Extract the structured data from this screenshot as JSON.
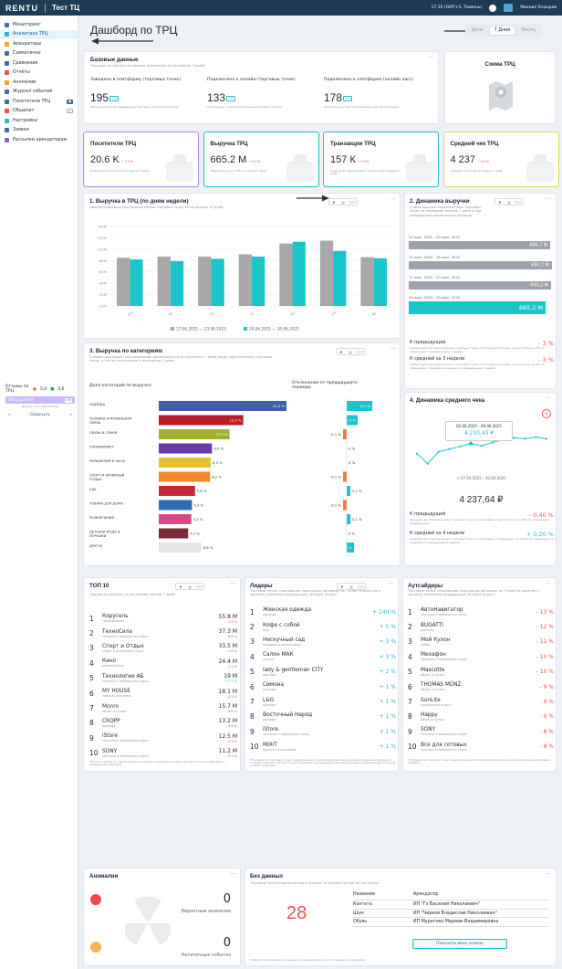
{
  "topbar": {
    "logo": "RENTU",
    "mall": "Тест ТЦ",
    "time": "17:35 (GMT+5, Тюмень)",
    "user": "Михаил Козырев"
  },
  "sidebar": {
    "items": [
      {
        "label": "Мониторинг",
        "color": "#3d6ea3"
      },
      {
        "label": "Аналитика ТРЦ",
        "color": "#2ab8c9",
        "active": true
      },
      {
        "label": "Арендаторы",
        "color": "#f0a12a"
      },
      {
        "label": "Схематично",
        "color": "#3d6ea3"
      },
      {
        "label": "Сравнение",
        "color": "#3d6ea3"
      },
      {
        "label": "Отчёты",
        "color": "#e9544a"
      },
      {
        "label": "Аномалии",
        "color": "#f0a12a"
      },
      {
        "label": "Журнал событий",
        "color": "#3d6ea3"
      },
      {
        "label": "Посетители ТРЦ",
        "color": "#3d6ea3",
        "badge": "●"
      },
      {
        "label": "Общепит",
        "color": "#e9544a",
        "badge": "◻"
      },
      {
        "label": "Настройки",
        "color": "#2ab8c9"
      },
      {
        "label": "Заявки",
        "color": "#3d6ea3"
      },
      {
        "label": "Рассылки арендаторам",
        "color": "#8e5fd6"
      }
    ],
    "reviews_label": "Отзывы по ТРЦ",
    "rating1": "5,0",
    "rating2": "4,6",
    "appeals": "Обращения",
    "appeals_badge": "199",
    "version": "Версия 4.0.1 (20.06.2025)",
    "collapse": "Свернуть"
  },
  "header": {
    "title": "Дашборд по ТРЦ",
    "periods": [
      "День",
      "7 Дней",
      "Месяц"
    ]
  },
  "basic": {
    "title": "Базовые данные",
    "subtitle": "Текущее состояние платформы (изменение за последние 7 дней)",
    "cols": [
      {
        "label": "Заведено в платформу (торговых точек)",
        "value": "195",
        "badge": "+10",
        "note": "Общее количество заведенных торговых точек в платформу"
      },
      {
        "label": "Подключено к онлайн (торговых точек)",
        "value": "133",
        "badge": "+12",
        "note": "Подключено к автоматизированному сбору продаж"
      },
      {
        "label": "Подключено к платформе (онлайн касс)",
        "value": "178",
        "badge": "+12",
        "note": "Подключено к автоматизированному сбору продаж"
      }
    ]
  },
  "scheme": {
    "title": "Схема ТРЦ"
  },
  "kpis": [
    {
      "title": "Посетители ТРЦ",
      "value": "20.6 K",
      "delta": "+ 0.3 %",
      "note": "Количество посетителей за неделю 7 дней",
      "border": "#a98ee0"
    },
    {
      "title": "Выручка ТРЦ",
      "value": "665.2 М",
      "delta": "+ 0.4 %",
      "note": "Общая выручка по ТРЦ за неделю 7 дней",
      "border": "#2ab8c9"
    },
    {
      "title": "Транзакции ТРЦ",
      "value": "157 К",
      "delta": "+ 0.3 %",
      "note": "Количество транзакций по чекам в ТРЦ за неделю 7 дней",
      "border": "#2ab8c9"
    },
    {
      "title": "Средний чек ТРЦ",
      "value": "4 237",
      "delta": "+ 0.4 %",
      "note": "Средний чек по ТРЦ за неделю 7 дней",
      "border": "#e5d45a"
    }
  ],
  "rev_days": {
    "title": "1. Выручка в ТРЦ (по дням недели)",
    "subtitle": "Общая сумма выручки подключенных торговых точек за последние 14 дней",
    "toggle": [
      "₽",
      "▦",
      "TOP"
    ]
  },
  "dyn_rev": {
    "title": "2. Динамика выручки",
    "subtitle": "Сумма выручки подключенных торговых точек за последние полные 7 дней и три предыдущие аналогичных периода",
    "periods": [
      {
        "label": "03 июн. 2025 - 09 июн. 2025",
        "value": "686,7 М"
      },
      {
        "label": "10 июн. 2025 - 16 июн. 2025",
        "value": "694,2 М"
      },
      {
        "label": "17 июн. 2025 - 23 июн. 2025",
        "value": "690,2 М"
      },
      {
        "label": "24 июн. 2025 - 30 июн. 2025",
        "value": "665,2 М"
      }
    ],
    "prev_label": "К предыдущей",
    "prev_val": "- 3 %",
    "prev_note": "Сумма выручки подключенных торговых точек за последние полные 7 дней упала на 3% по сравнению с предыдущими 7 днями",
    "three_label": "К средней за 3 недели",
    "three_val": "- 3 %",
    "three_note": "Сумма выручки подключенных торговых точек за последние полные 7 дней упала на 3% по сравнению с средним значением за предыдущие 3 недели"
  },
  "cat": {
    "title": "3. Выручка по категориям",
    "subtitle": "График показывает распределение долей выручки за последние 7 дней среди подключенных торговых точек, а так же отклонение к последним 7 дням",
    "left_title": "Доля категорий по выручке",
    "right_title": "Отклонение от предыдущего периода",
    "rows": [
      {
        "name": "ОДЕЖДА",
        "pct": "20,4 %",
        "dev": "0,7 %"
      },
      {
        "name": "ТЕХНИКА И МОБИЛЬНАЯ СВЯЗЬ",
        "pct": "13,5 %",
        "dev": "0,3 %"
      },
      {
        "name": "ОБУВЬ И СУМКИ",
        "pct": "11,3 %",
        "dev": "-0,1 %"
      },
      {
        "name": "ГИПЕРМАРКЕТ",
        "pct": "8,5 %",
        "dev": "0 %"
      },
      {
        "name": "УКРАШЕНИЯ И ЧАСЫ",
        "pct": "8,3 %",
        "dev": "0 %"
      },
      {
        "name": "СПОРТ И АКТИВНЫЙ ОТДЫХ",
        "pct": "8,2 %",
        "dev": "-0,1 %"
      },
      {
        "name": "ЕДА",
        "pct": "5,8 %",
        "dev": "0,1 %"
      },
      {
        "name": "ТОВАРЫ ДЛЯ ДОМА",
        "pct": "5,3 %",
        "dev": "-0,1 %"
      },
      {
        "name": "РАЗВЛЕЧЕНИЯ",
        "pct": "5,2 %",
        "dev": "0,1 %"
      },
      {
        "name": "ДЕТСКАЯ МОДА И ИГРУШКИ",
        "pct": "4,7 %",
        "dev": "0 %"
      },
      {
        "name": "ДРУГОЕ",
        "pct": "6,8 %",
        "dev": "0,2 %"
      }
    ]
  },
  "avg": {
    "title": "4. Динамика среднего чека",
    "tooltip_date": "02.06.2025 - 09.06.2025",
    "tooltip_val": "4 230,43 ₽",
    "range": "07.04.2025 - 30.06.2025",
    "value": "4 237,64 ₽",
    "prev_label": "К предыдущей",
    "prev_val": "- 0,40 %",
    "prev_note": "Средний чек подключенных торговых точек за последние 7 дней упал на 0,40% по сравнению с предыдущей",
    "four_label": "К средней за 4 недели",
    "four_val": "+ 0,20 %",
    "four_note": "Средний чек подключенных торговых точек за последние 7 дней вырос на 0,20% по сравнению со средним за предыдущие 4 недели"
  },
  "top10": {
    "title": "ТОП 10",
    "subtitle": "Лидеры по выручке за последние полные 7 дней",
    "rows": [
      {
        "n": "1",
        "name": "Корусель",
        "cat": "гипермаркет",
        "val": "55.8 М",
        "d": "- 3.8 %"
      },
      {
        "n": "2",
        "name": "ТехноСила",
        "cat": "техника и мобильная связь",
        "val": "37.3 М",
        "d": "- 6.9 %"
      },
      {
        "n": "3",
        "name": "Спорт и Отдых",
        "cat": "спорт и активный отдых",
        "val": "33.5 М",
        "d": "- 2.6 %"
      },
      {
        "n": "4",
        "name": "Кино",
        "cat": "развлечения",
        "val": "24.4 М",
        "d": "- 2.1 %"
      },
      {
        "n": "5",
        "name": "Технологии АБ",
        "cat": "техника и мобильная связь",
        "val": "19 М",
        "d": "+ 0.2 %"
      },
      {
        "n": "6",
        "name": "MY HOUSE",
        "cat": "товары для дома",
        "val": "18.1 М",
        "d": "- 4.5 %"
      },
      {
        "n": "7",
        "name": "Monro",
        "cat": "обувь и сумки",
        "val": "15.7 М",
        "d": "- 0.8 %"
      },
      {
        "n": "8",
        "name": "CROPP",
        "cat": "одежда",
        "val": "13.2 М",
        "d": "- 4.6 %"
      },
      {
        "n": "9",
        "name": "iStore",
        "cat": "техника и мобильная связь",
        "val": "12.5 М",
        "d": "- 2.9 %"
      },
      {
        "n": "10",
        "name": "SONY",
        "cat": "техника и мобильная связь",
        "val": "11.2 М",
        "d": "- 9.3 %"
      }
    ],
    "footnote": "*Число со знаком +/- рядом номера показывает изменение позиции торговой точки по сравнению с предыдущим периодом"
  },
  "leaders": {
    "title": "Лидеры",
    "subtitle": "Торговые точки, показавшие наилучшую динамику за 7 дней по выручке к средним значениям предыдущих четырех недель",
    "rows": [
      {
        "n": "1",
        "name": "Женская одежда",
        "cat": "одежда",
        "val": "+ 240 %"
      },
      {
        "n": "2",
        "name": "Кофе с собой",
        "cat": "еда",
        "val": "+ 5 %"
      },
      {
        "n": "3",
        "name": "Нескучный сад",
        "cat": "подарки и аксессуары",
        "val": "+ 3 %"
      },
      {
        "n": "4",
        "name": "Салон МАК",
        "cat": "услуги",
        "val": "+ 3 %"
      },
      {
        "n": "5",
        "name": "lady & gentleman CITY",
        "cat": "одежда",
        "val": "+ 2 %"
      },
      {
        "n": "6",
        "name": "Симона",
        "cat": "одежда",
        "val": "+ 1 %"
      },
      {
        "n": "7",
        "name": "L&G",
        "cat": "одежда",
        "val": "+ 1 %"
      },
      {
        "n": "8",
        "name": "Восточный Наряд",
        "cat": "одежда",
        "val": "+ 1 %"
      },
      {
        "n": "9",
        "name": "iStore",
        "cat": "техника и мобильная связь",
        "val": "+ 1 %"
      },
      {
        "n": "10",
        "name": "MIXIT",
        "cat": "красота и здоровье",
        "val": "+ 1 %"
      }
    ],
    "footnote": "*Учитываются торговые точки, подключенные к платформе более месяца назад и имеющие продажи в текущем периоде. При включенных позициях в предыдущем периоде возможны отрицательные значения в связи с уборками"
  },
  "outsiders": {
    "title": "Аутсайдеры",
    "subtitle": "Торговые точки, показавшие наихудшую динамику за 7 дней по выручке к средним значениям предыдущих четырех недель",
    "rows": [
      {
        "n": "1",
        "name": "АвтоНавигатор",
        "cat": "техника и мобильная связь",
        "val": "- 13 %"
      },
      {
        "n": "2",
        "name": "BUGATTI",
        "cat": "одежда",
        "val": "- 12 %"
      },
      {
        "n": "3",
        "name": "Мой Кухон",
        "cat": "хобби",
        "val": "- 11 %"
      },
      {
        "n": "4",
        "name": "Мехафон",
        "cat": "техника и мобильная связь",
        "val": "- 10 %"
      },
      {
        "n": "5",
        "name": "Mascotte",
        "cat": "обувь и сумки",
        "val": "- 10 %"
      },
      {
        "n": "6",
        "name": "THOMAS MÜNZ",
        "cat": "обувь и сумки",
        "val": "- 9 %"
      },
      {
        "n": "7",
        "name": "SunLite",
        "cat": "украшения и часы",
        "val": "- 9 %"
      },
      {
        "n": "8",
        "name": "Happy",
        "cat": "обувь и сумки",
        "val": "- 9 %"
      },
      {
        "n": "9",
        "name": "SONY",
        "cat": "техника и мобильная связь",
        "val": "- 8 %"
      },
      {
        "n": "10",
        "name": "Все для сотовых",
        "cat": "техника и мобильная связь",
        "val": "- 8 %"
      }
    ],
    "footnote": "*Учитываются торговые точки, подключенные к платформе более месяца назад и имеющие регулярные продажи"
  },
  "anom": {
    "title": "Аномалии",
    "v1": "0",
    "l1": "Вероятные аномалии",
    "v2": "0",
    "l2": "Нетипичные события"
  },
  "nodata": {
    "title": "Без данных",
    "subtitle": "Торговые точки подключенные к онлайн, но данные по ним не поступают",
    "count": "28",
    "col1": "Название",
    "col2": "Арендатор",
    "rows": [
      {
        "a": "Контата",
        "b": "ИП \"Гз Василий Николаевич\""
      },
      {
        "a": "Шум",
        "b": "ИП \"Чирков Владислав Николаевич\""
      },
      {
        "a": "Обувь",
        "b": "ИП Муратова Мариам Владимировна"
      }
    ],
    "button": "Показать весь список",
    "footnote": "Требуется проверить актуальность арендаторов и их состояние на платформе"
  },
  "chart_data": [
    {
      "type": "bar",
      "title": "1. Выручка в ТРЦ (по дням недели)",
      "categories": [
        "Пн",
        "Вт",
        "Ср",
        "Чт",
        "Пт",
        "Сб",
        "Вс"
      ],
      "yticks": [
        "140М",
        "120М",
        "100М",
        "80М",
        "60М",
        "40М",
        "20М",
        "0.00"
      ],
      "ylim": [
        0,
        140
      ],
      "series": [
        {
          "name": "17.06.2025 — 23.06.2025",
          "color": "#a8a8a8",
          "values": [
            85,
            87,
            87,
            91,
            110,
            115,
            86
          ]
        },
        {
          "name": "24.06.2025 — 30.06.2025",
          "color": "#1bc4c9",
          "values": [
            82,
            79,
            83,
            87,
            113,
            97,
            84
          ]
        }
      ]
    },
    {
      "type": "bar",
      "title": "2. Динамика выручки",
      "categories": [
        "03 июн. 2025 - 09 июн. 2025",
        "10 июн. 2025 - 16 июн. 2025",
        "17 июн. 2025 - 23 июн. 2025",
        "24 июн. 2025 - 30 июн. 2025"
      ],
      "values": [
        686.7,
        694.2,
        690.2,
        665.2
      ]
    },
    {
      "type": "bar",
      "title": "3. Выручка по категориям",
      "categories": [
        "ОДЕЖДА",
        "ТЕХНИКА И МОБИЛЬНАЯ СВЯЗЬ",
        "ОБУВЬ И СУМКИ",
        "ГИПЕРМАРКЕТ",
        "УКРАШЕНИЯ И ЧАСЫ",
        "СПОРТ И АКТИВНЫЙ ОТДЫХ",
        "ЕДА",
        "ТОВАРЫ ДЛЯ ДОМА",
        "РАЗВЛЕЧЕНИЯ",
        "ДЕТСКАЯ МОДА И ИГРУШКИ",
        "ДРУГОЕ"
      ],
      "values": [
        20.4,
        13.5,
        11.3,
        8.5,
        8.3,
        8.2,
        5.8,
        5.3,
        5.2,
        4.7,
        6.8
      ],
      "deviation": [
        0.7,
        0.3,
        -0.1,
        0,
        0,
        -0.1,
        0.1,
        -0.1,
        0.1,
        0,
        0.2
      ],
      "colors": [
        "#3f5fa8",
        "#b81c26",
        "#a3b02f",
        "#6b3aa6",
        "#e4c42e",
        "#f08a29",
        "#c8273a",
        "#2f6cb5",
        "#d84a83",
        "#7b2b3a",
        "#e6e6e6"
      ]
    },
    {
      "type": "line",
      "title": "4. Динамика среднего чека",
      "values": [
        4215,
        4200,
        4218,
        4222,
        4226,
        4230.43,
        4227,
        4232,
        4236,
        4239,
        4237.64,
        4240,
        4237.64
      ]
    }
  ]
}
